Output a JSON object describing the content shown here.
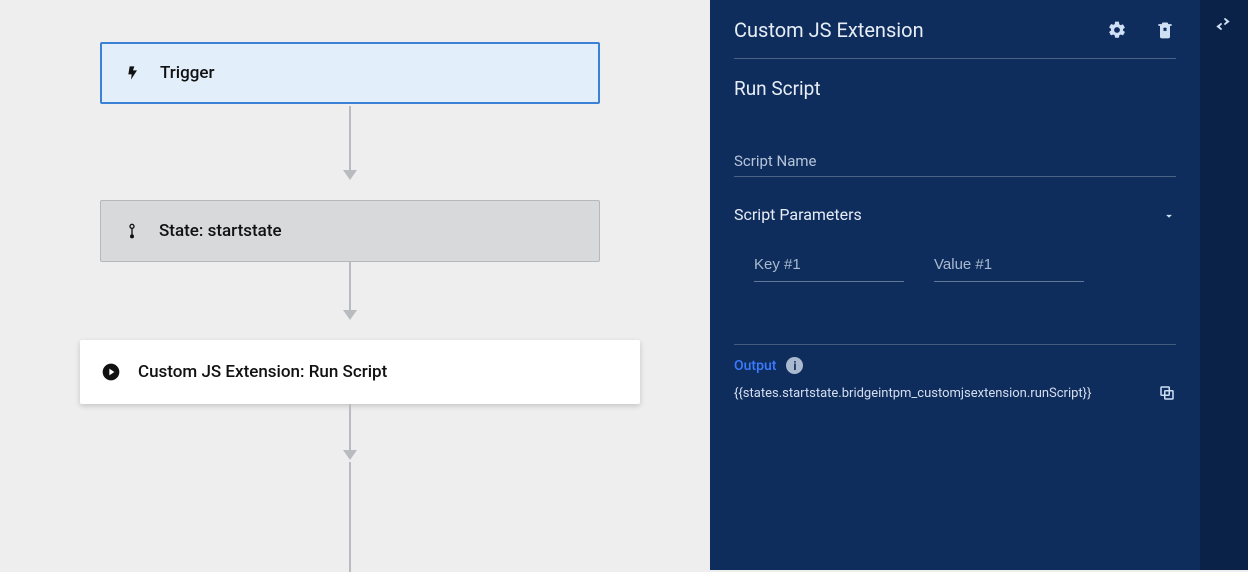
{
  "canvas": {
    "nodes": {
      "trigger": {
        "label": "Trigger"
      },
      "state": {
        "label": "State: startstate"
      },
      "action": {
        "label": "Custom JS Extension: Run Script"
      }
    }
  },
  "panel": {
    "title": "Custom JS Extension",
    "subtitle": "Run Script",
    "script_name_label": "Script Name",
    "script_params_label": "Script Parameters",
    "params": {
      "key_placeholder": "Key #1",
      "value_placeholder": "Value #1"
    },
    "output_label": "Output",
    "output_value": "{{states.startstate.bridgeintpm_customjsextension.runScript}}"
  }
}
